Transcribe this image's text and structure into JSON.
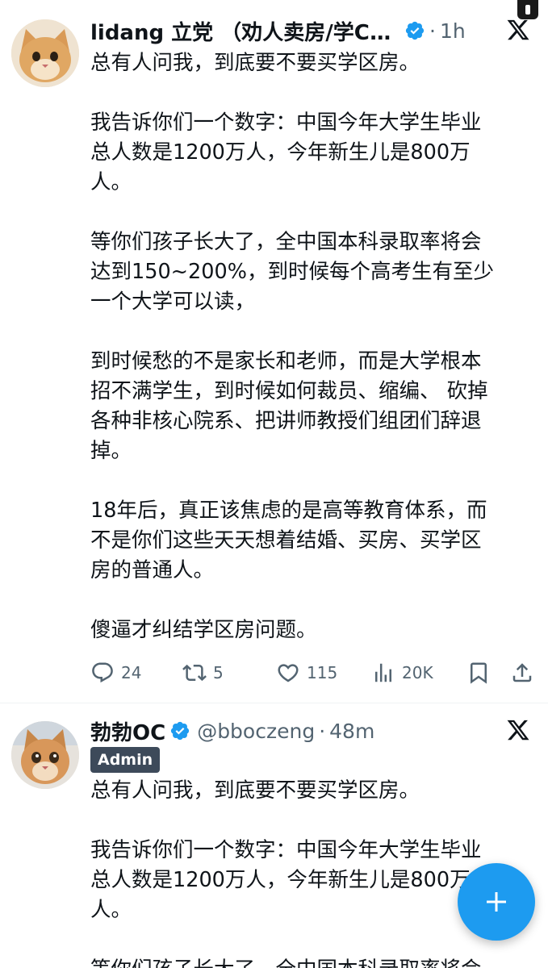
{
  "tweets": [
    {
      "author": {
        "display_name": "lidang 立党 （劝人卖房/学CS...",
        "verified": true,
        "avatar": "cat-avatar"
      },
      "time": "1h",
      "platform_icon": "x-logo-icon",
      "body": {
        "p1": [
          "总有人问我，到底要不要买学区房。"
        ],
        "p2": [
          "我告诉你们一个数字：中国今年大学生毕业",
          "总人数是1200万人，今年新生儿是800万",
          "人。"
        ],
        "p3": [
          "等你们孩子长大了，全中国本科录取率将会",
          "达到150~200%，到时候每个高考生有至少",
          "一个大学可以读，"
        ],
        "p4": [
          "到时候愁的不是家长和老师，而是大学根本",
          "招不满学生，到时候如何裁员、缩编、 砍掉",
          "各种非核心院系、把讲师教授们组团们辞退",
          "掉。"
        ],
        "p5": [
          "18年后，真正该焦虑的是高等教育体系，而",
          "不是你们这些天天想着结婚、买房、买学区",
          "房的普通人。"
        ],
        "p6": [
          "傻逼才纠结学区房问题。"
        ]
      },
      "actions": {
        "replies": "24",
        "retweets": "5",
        "likes": "115",
        "views": "20K"
      }
    },
    {
      "author": {
        "display_name": "勃勃OC",
        "verified": true,
        "handle": "@bboczeng",
        "badge": "Admin",
        "avatar": "cat-avatar"
      },
      "time": "48m",
      "platform_icon": "x-logo-icon",
      "body": {
        "p1": [
          "总有人问我，到底要不要买学区房。"
        ],
        "p2": [
          "我告诉你们一个数字：中国今年大学生毕业",
          "总人数是1200万人，今年新生儿是800万",
          "人。"
        ],
        "p3": [
          "等你们孩子长大了，全中国本科录取率将会"
        ]
      }
    }
  ],
  "separator": "·",
  "fab": {
    "icon": "plus-icon",
    "color": "#1d9bf0"
  },
  "colors": {
    "text": "#0f1419",
    "secondary": "#536471",
    "verified": "#1d9bf0",
    "badge_bg": "#3d4a5a"
  }
}
